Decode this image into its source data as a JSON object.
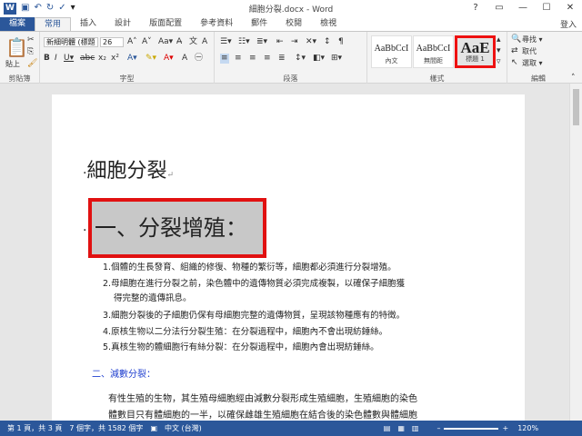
{
  "window": {
    "title": "細胞分裂.docx - Word",
    "controls": [
      "?",
      "▭",
      "—",
      "☐",
      "✕"
    ]
  },
  "qat": {
    "icons": [
      "save-icon",
      "undo-icon",
      "redo-icon",
      "check-icon",
      "customize-icon"
    ]
  },
  "tabs": [
    "檔案",
    "常用",
    "插入",
    "設計",
    "版面配置",
    "參考資料",
    "郵件",
    "校閱",
    "檢視"
  ],
  "active_tab": "常用",
  "login": "登入",
  "ribbon": {
    "clipboard": {
      "label": "剪貼簿",
      "paste": "貼上"
    },
    "font": {
      "label": "字型",
      "name": "新細明體 (標題",
      "size": "26"
    },
    "paragraph": {
      "label": "段落"
    },
    "styles": {
      "label": "樣式",
      "items": [
        {
          "sample": "AaBbCcI",
          "name": "內文"
        },
        {
          "sample": "AaBbCcI",
          "name": "無間距"
        },
        {
          "sample": "AaE",
          "name": "標題 1"
        }
      ]
    },
    "editing": {
      "label": "編輯",
      "items": [
        "尋找 ▾",
        "取代",
        "選取 ▾"
      ]
    }
  },
  "document": {
    "title": "細胞分裂",
    "heading1": "一、分裂增殖：",
    "list": [
      "1.個體的生長發育、組織的修復、物種的繁衍等，細胞都必須進行分裂增殖。",
      "2.母細胞在進行分裂之前，染色體中的遺傳物質必須完成複製，以確保子細胞獲",
      "得完整的遺傳訊息。",
      "3.細胞分裂後的子細胞仍保有母細胞完整的遺傳物質，呈現該物種應有的特徵。",
      "4.原核生物以二分法行分裂生殖：在分裂過程中，細胞內不會出現紡錘絲。",
      "5.真核生物的體細胞行有絲分裂：在分裂過程中，細胞內會出現紡錘絲。"
    ],
    "heading2": "二、減數分裂：",
    "para1": "有性生殖的生物，其生殖母細胞經由減數分裂形成生殖細胞，生殖細胞的染色",
    "para2": "體數目只有體細胞的一半，以確保雌雄生殖細胞在結合後的染色體數與體細胞"
  },
  "status": {
    "page": "第 1 頁，共 3 頁",
    "words": "7 個字，共 1582 個字",
    "lang": "中文 (台灣)",
    "zoom": "120%"
  },
  "colors": {
    "brand": "#2b579a",
    "heading2": "#1f3fcf",
    "selection": "#c8c8c8",
    "highlight": "#e11111"
  }
}
